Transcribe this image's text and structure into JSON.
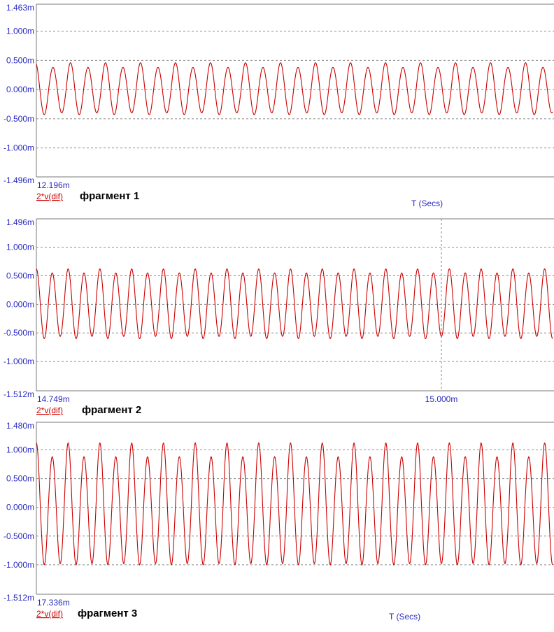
{
  "colors": {
    "trace": "#cc0000",
    "axis_text": "#2a2ac0",
    "grid": "#8a8a8a",
    "background": "#ffffff"
  },
  "chart_data": [
    {
      "type": "line",
      "title": "фрагмент 1",
      "trace_label": "2*v(dif)",
      "xlabel": "T (Secs)",
      "ylim": [
        -1.496,
        1.463
      ],
      "y_top_label": "1.463m",
      "y_bottom_label": "-1.496m",
      "y_ticks": [
        {
          "value": 1.0,
          "label": "1.000m"
        },
        {
          "value": 0.5,
          "label": "0.500m"
        },
        {
          "value": 0.0,
          "label": "0.000m"
        },
        {
          "value": -0.5,
          "label": "-0.500m"
        },
        {
          "value": -1.0,
          "label": "-1.000m"
        }
      ],
      "x_start_label": "12.196m",
      "x_marker": null,
      "series": [
        {
          "cycles": 29.5,
          "phase": 0.3,
          "amplitude_pos": [
            0.46,
            0.38
          ],
          "amplitude_neg": [
            -0.43,
            -0.4
          ],
          "offset": 0.0,
          "end_value": -0.25
        }
      ],
      "grid": true
    },
    {
      "type": "line",
      "title": "фрагмент 2",
      "trace_label": "2*v(dif)",
      "xlabel": "",
      "ylim": [
        -1.512,
        1.496
      ],
      "y_top_label": "1.496m",
      "y_bottom_label": "-1.512m",
      "y_ticks": [
        {
          "value": 1.0,
          "label": "1.000m"
        },
        {
          "value": 0.5,
          "label": "0.500m"
        },
        {
          "value": 0.0,
          "label": "0.000m"
        },
        {
          "value": -0.5,
          "label": "-0.500m"
        },
        {
          "value": -1.0,
          "label": "-1.000m"
        }
      ],
      "x_start_label": "14.749m",
      "x_marker": {
        "label": "15.000m"
      },
      "series": [
        {
          "cycles": 32.5,
          "phase": 0.25,
          "amplitude_pos": [
            0.62,
            0.55
          ],
          "amplitude_neg": [
            -0.6,
            -0.56
          ],
          "offset": 0.0,
          "end_value": 0.5
        }
      ],
      "grid": true
    },
    {
      "type": "line",
      "title": "фрагмент 3",
      "trace_label": "2*v(dif)",
      "xlabel": "T (Secs)",
      "ylim": [
        -1.512,
        1.48
      ],
      "y_top_label": "1.480m",
      "y_bottom_label": "-1.512m",
      "y_ticks": [
        {
          "value": 1.0,
          "label": "1.000m"
        },
        {
          "value": 0.5,
          "label": "0.500m"
        },
        {
          "value": 0.0,
          "label": "0.000m"
        },
        {
          "value": -0.5,
          "label": "-0.500m"
        },
        {
          "value": -1.0,
          "label": "-1.000m"
        }
      ],
      "x_start_label": "17.336m",
      "x_marker": null,
      "series": [
        {
          "cycles": 32.5,
          "phase": 0.25,
          "amplitude_pos": [
            1.12,
            0.88
          ],
          "amplitude_neg": [
            -1.0,
            -0.98
          ],
          "offset": 0.0,
          "end_value": 0.85
        }
      ],
      "grid": true
    }
  ]
}
